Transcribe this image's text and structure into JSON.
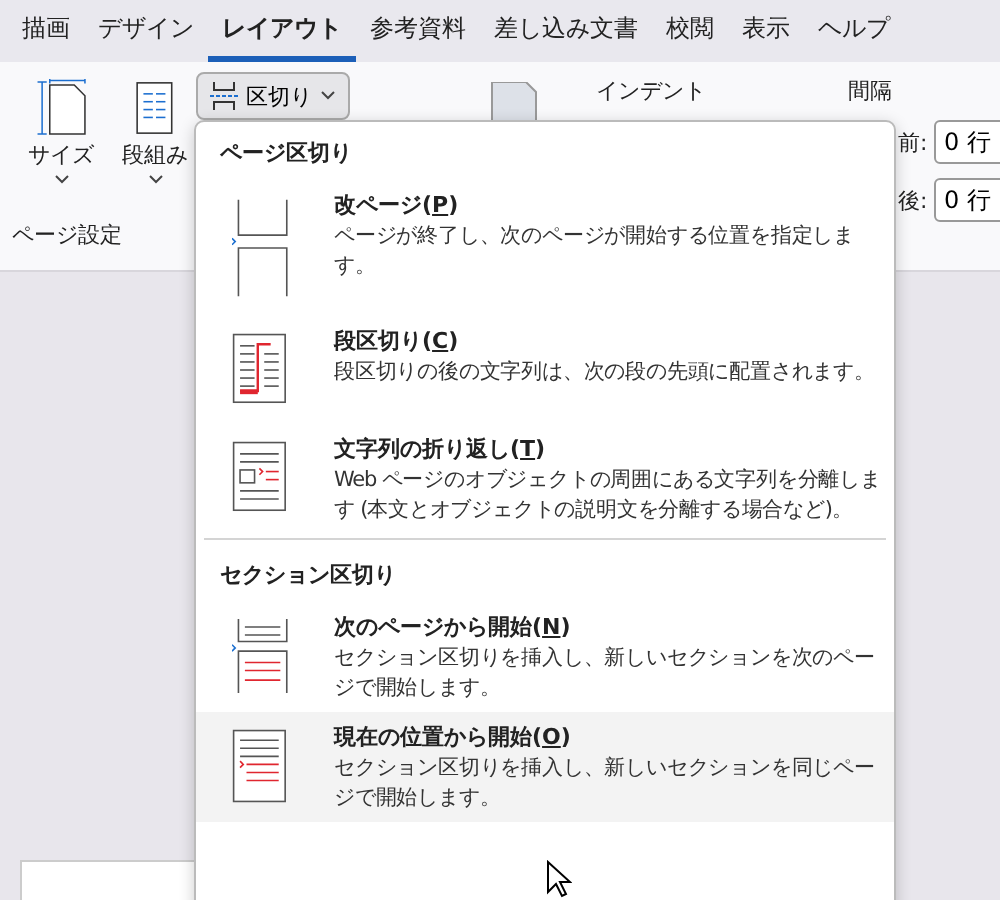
{
  "tabs": [
    {
      "label": "描画",
      "selected": false
    },
    {
      "label": "デザイン",
      "selected": false
    },
    {
      "label": "レイアウト",
      "selected": true
    },
    {
      "label": "参考資料",
      "selected": false
    },
    {
      "label": "差し込み文書",
      "selected": false
    },
    {
      "label": "校閲",
      "selected": false
    },
    {
      "label": "表示",
      "selected": false
    },
    {
      "label": "ヘルプ",
      "selected": false
    }
  ],
  "ribbon": {
    "size_button": "サイズ",
    "columns_button": "段組み",
    "breaks_button": {
      "label": "区切り",
      "expanded": true
    },
    "indent_label": "インデント",
    "spacing_label": "間隔",
    "before_label": "前:",
    "before_value": "0 行",
    "after_label": "後:",
    "after_value": "0 行",
    "group_label": "ページ設定"
  },
  "breaks_menu": {
    "sections": [
      {
        "heading": "ページ区切り",
        "items": [
          {
            "kind": "page",
            "title": "改ページ(",
            "key": "P",
            "title_end": ")",
            "description": "ページが終了し、次のページが開始する位置を指定します。",
            "hovered": false
          },
          {
            "kind": "column",
            "title": "段区切り(",
            "key": "C",
            "title_end": ")",
            "description": "段区切りの後の文字列は、次の段の先頭に配置されます。",
            "hovered": false
          },
          {
            "kind": "wrap",
            "title": "文字列の折り返し(",
            "key": "T",
            "title_end": ")",
            "description": "Web ページのオブジェクトの周囲にある文字列を分離します (本文とオブジェクトの説明文を分離する場合など)。",
            "hovered": false
          }
        ]
      },
      {
        "heading": "セクション区切り",
        "items": [
          {
            "kind": "next_page",
            "title": "次のページから開始(",
            "key": "N",
            "title_end": ")",
            "description": "セクション区切りを挿入し、新しいセクションを次のページで開始します。",
            "hovered": false
          },
          {
            "kind": "continuous",
            "title": "現在の位置から開始(",
            "key": "O",
            "title_end": ")",
            "description": "セクション区切りを挿入し、新しいセクションを同じページで開始します。",
            "hovered": true
          }
        ]
      }
    ]
  }
}
